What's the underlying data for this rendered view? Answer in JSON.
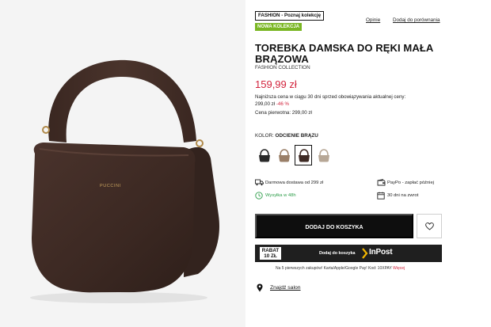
{
  "product": {
    "badge_collection": "FASHION - Poznaj kolekcję",
    "badge_new": "NOWA KOLEKCJA",
    "link_reviews": "Opinie",
    "link_compare": "Dodaj do porównania",
    "title": "TOREBKA DAMSKA DO RĘKI MAŁA BRĄZOWA",
    "brand": "FASHION COLLECTION",
    "price": "159,99 zł",
    "lowest_price_text": "Najniższa cena w ciągu 30 dni sprzed obowiązywania aktualnej ceny:",
    "lowest_price_value": "299,00 zł",
    "lowest_price_discount": "-46 %",
    "first_price": "Cena pierwotna: 299,00 zł",
    "bag_logo": "PUCCINI",
    "color_label": "KOLOR:",
    "color_value": "ODCIENIE BRĄZU",
    "swatches": [
      {
        "name": "black",
        "color": "#2a2a2a",
        "selected": false
      },
      {
        "name": "taupe",
        "color": "#9a7f68",
        "selected": false
      },
      {
        "name": "dark-brown",
        "color": "#3e2a24",
        "selected": true
      },
      {
        "name": "beige",
        "color": "#b7a796",
        "selected": false
      }
    ]
  },
  "perks": {
    "delivery": "Darmowa dostawa od 299 zł",
    "shipping": "Wysyłka w 48h",
    "paypo": "PayPo - zapłać później",
    "returns": "30 dni na zwrot"
  },
  "actions": {
    "add_to_cart": "DODAJ DO KOSZYKA"
  },
  "inpost": {
    "rabat_line1": "RABAT",
    "rabat_line2": "10 ZŁ",
    "add_label": "Dodaj do koszyka",
    "logo_text": "InPost"
  },
  "promo": {
    "text": "Na 5 pierwszych zakupów! Karta/Apple/Google Pay! Kod: 10XPAY",
    "more": "Więcej"
  },
  "store": {
    "label": "Znajdź salon"
  },
  "colors": {
    "accent_red": "#d2233c",
    "new_green": "#7ab623",
    "ship_green": "#2e9d4a",
    "bag_brown": "#3e2a24"
  }
}
